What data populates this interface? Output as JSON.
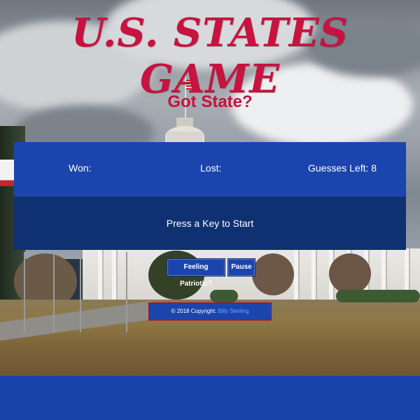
{
  "header": {
    "title": "U.S. STATES GAME",
    "subtitle": "Got State?"
  },
  "scoreboard": {
    "won_label": "Won:",
    "lost_label": "Lost:",
    "guesses_left_label": "Guesses Left: 8"
  },
  "message": {
    "text": "Press a Key to Start"
  },
  "controls": {
    "patriotic_label": "Feeling Patriotic?",
    "pause_label": "Pause"
  },
  "footer": {
    "copyright": "© 2018 Copyright: ",
    "author": "Billy Sterling"
  },
  "colors": {
    "title": "#c8123f",
    "panel": "#1b45ad",
    "panel_dark": "#0f3171",
    "text": "#ffffff",
    "link": "#6fa4ff"
  }
}
